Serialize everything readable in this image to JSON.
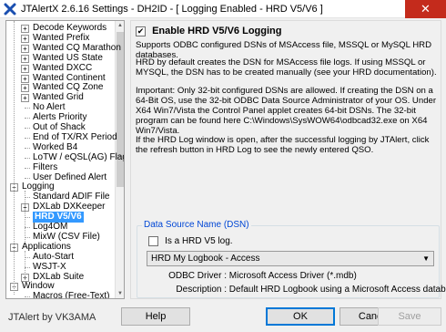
{
  "window": {
    "title": "JTAlertX 2.6.16 Settings  -  DH2ID  -  [ Logging Enabled - HRD V5/V6 ]",
    "close_glyph": "✕"
  },
  "tree": {
    "items": [
      {
        "label": "Decode Keywords",
        "expander": "+"
      },
      {
        "label": "Wanted Prefix",
        "expander": "+"
      },
      {
        "label": "Wanted CQ Marathon",
        "expander": "+"
      },
      {
        "label": "Wanted US State",
        "expander": "+"
      },
      {
        "label": "Wanted DXCC",
        "expander": "+"
      },
      {
        "label": "Wanted Continent",
        "expander": "+"
      },
      {
        "label": "Wanted CQ Zone",
        "expander": "+"
      },
      {
        "label": "Wanted Grid",
        "expander": "+"
      },
      {
        "label": "No Alert",
        "expander": ""
      },
      {
        "label": "Alerts Priority",
        "expander": ""
      },
      {
        "label": "Out of Shack",
        "expander": ""
      },
      {
        "label": "End of TX/RX Period",
        "expander": ""
      },
      {
        "label": "Worked B4",
        "expander": ""
      },
      {
        "label": "LoTW / eQSL(AG) Flags",
        "expander": ""
      },
      {
        "label": "Filters",
        "expander": ""
      },
      {
        "label": "User Defined Alert",
        "expander": ""
      },
      {
        "label": "Logging",
        "expander": "−"
      },
      {
        "label": "Standard ADIF File",
        "expander": ""
      },
      {
        "label": "DXLab DXKeeper",
        "expander": "+"
      },
      {
        "label": "HRD V5/V6",
        "expander": ""
      },
      {
        "label": "Log4OM",
        "expander": ""
      },
      {
        "label": "MixW (CSV File)",
        "expander": ""
      },
      {
        "label": "Applications",
        "expander": "−"
      },
      {
        "label": "Auto-Start",
        "expander": ""
      },
      {
        "label": "WSJT-X",
        "expander": ""
      },
      {
        "label": "DXLab Suite",
        "expander": "+"
      },
      {
        "label": "Window",
        "expander": "−"
      },
      {
        "label": "Macros (Free-Text)",
        "expander": ""
      }
    ]
  },
  "content": {
    "enable_checked": "✔",
    "enable_label": "Enable HRD V5/V6 Logging",
    "paragraphs": [
      "Supports ODBC configured DSNs of MSAccess file, MSSQL or MySQL HRD databases.",
      "HRD by default creates the DSN for MSAccess file logs. If using MSSQL or MYSQL, the DSN has to be created manually (see your HRD documentation).",
      "Important: Only 32-bit configured DSNs are allowed. If creating the DSN on a 64-Bit OS, use the 32-bit ODBC Data Source Administrator of your OS. Under X64 Win7/Vista the Control Panel applet creates 64-bit DSNs. The 32-bit program can be found here C:\\Windows\\SysWOW64\\odbcad32.exe on X64 Win7/Vista.",
      "If the HRD Log window is open, after the successful logging by JTAlert, click the refresh button in HRD Log to see the newly entered QSO."
    ],
    "dsn": {
      "group_title": "Data Source Name (DSN)",
      "hrd_v5_checked": "",
      "hrd_v5_label": "Is a HRD V5 log.",
      "selected": "HRD My Logbook - Access",
      "arrow": "▼",
      "odbc_key": "ODBC Driver :",
      "odbc_value": "Microsoft Access Driver (*.mdb)",
      "desc_key": "Description :",
      "desc_value": "Default HRD Logbook using a Microsoft Access database"
    }
  },
  "footer": {
    "brand": "JTAlert by VK3AMA",
    "help": "Help",
    "ok": "OK",
    "cancel": "Cancel",
    "save": "Save"
  }
}
